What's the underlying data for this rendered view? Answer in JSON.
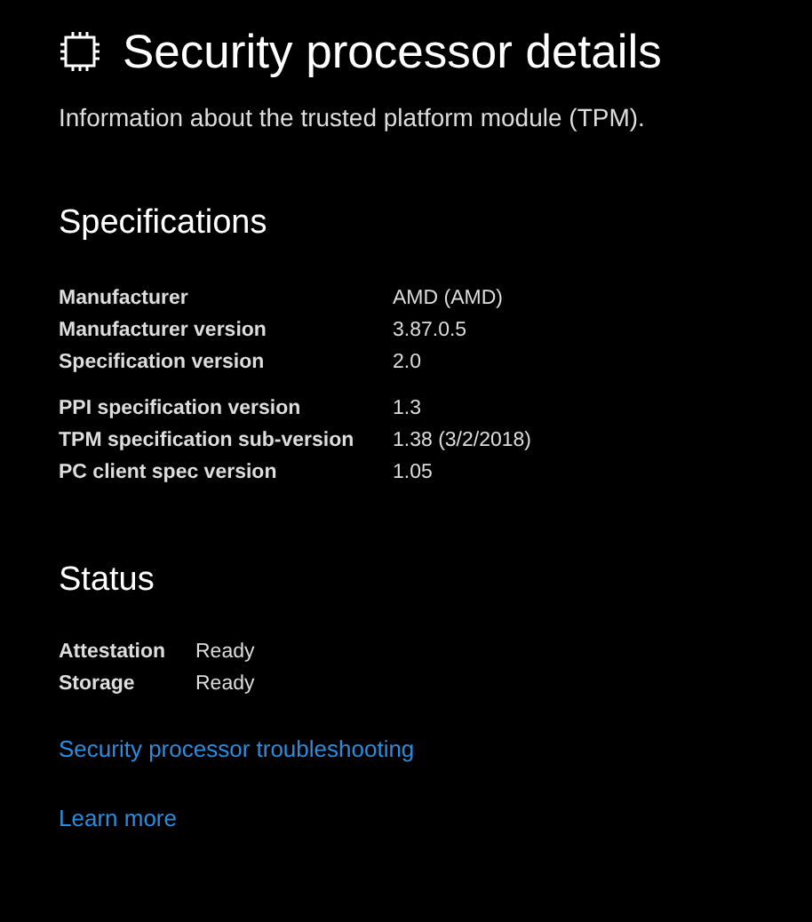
{
  "page": {
    "title": "Security processor details",
    "description": "Information about the trusted platform module (TPM)."
  },
  "specifications": {
    "heading": "Specifications",
    "groups": [
      [
        {
          "label": "Manufacturer",
          "value": "AMD (AMD)"
        },
        {
          "label": "Manufacturer version",
          "value": "3.87.0.5"
        },
        {
          "label": "Specification version",
          "value": "2.0"
        }
      ],
      [
        {
          "label": "PPI specification version",
          "value": "1.3"
        },
        {
          "label": "TPM specification sub-version",
          "value": "1.38 (3/2/2018)"
        },
        {
          "label": "PC client spec version",
          "value": "1.05"
        }
      ]
    ]
  },
  "status": {
    "heading": "Status",
    "rows": [
      {
        "label": "Attestation",
        "value": "Ready"
      },
      {
        "label": "Storage",
        "value": "Ready"
      }
    ]
  },
  "links": [
    "Security processor troubleshooting",
    "Learn more"
  ]
}
